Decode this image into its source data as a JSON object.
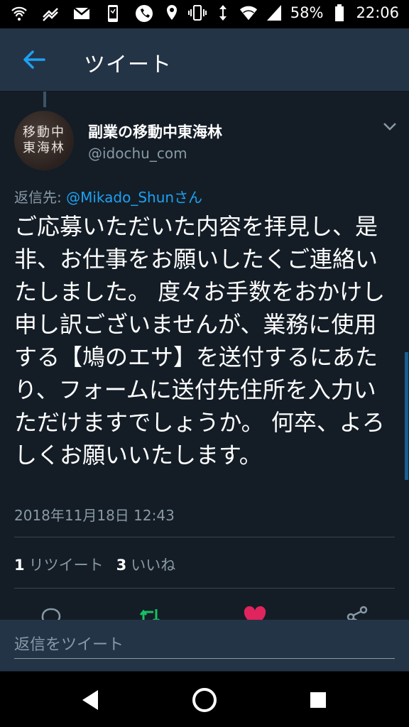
{
  "status_bar": {
    "battery_percent": "58%",
    "time": "22:06",
    "icons_left": [
      "wifi-call-icon",
      "signal-alt-icon",
      "gmail-icon",
      "phone-device-icon",
      "phone-icon"
    ],
    "icons_right": [
      "location-icon",
      "vibrate-icon",
      "data-arrows-icon",
      "wifi-icon",
      "cell-signal-icon",
      "battery-icon"
    ]
  },
  "app_bar": {
    "title": "ツイート",
    "back_icon": "arrow-left-icon"
  },
  "tweet": {
    "display_name": "副業の移動中東海林",
    "handle": "@idochu_com",
    "avatar_text_line1": "移動中",
    "avatar_text_line2": "東海林",
    "reply_label": "返信先: ",
    "reply_mention": "@Mikado_Shunさん",
    "text": "ご応募いただいた内容を拝見し、是非、お仕事をお願いしたくご連絡いたしました。 度々お手数をおかけし申し訳ございませんが、業務に使用する【鳩のエサ】を送付するにあたり、フォームに送付先住所を入力いただけますでしょうか。 何卒、よろしくお願いいたします。",
    "timestamp": "2018年11月18日 12:43",
    "retweet_count": "1",
    "retweet_label": "リツイート",
    "like_count": "3",
    "like_label": "いいね"
  },
  "compose": {
    "placeholder": "返信をツイート"
  },
  "colors": {
    "background": "#141d26",
    "app_bar": "#243447",
    "accent_blue": "#1da1f2",
    "secondary_text": "#8899a6",
    "retweet_green": "#17bf63",
    "like_red": "#e0245e"
  }
}
